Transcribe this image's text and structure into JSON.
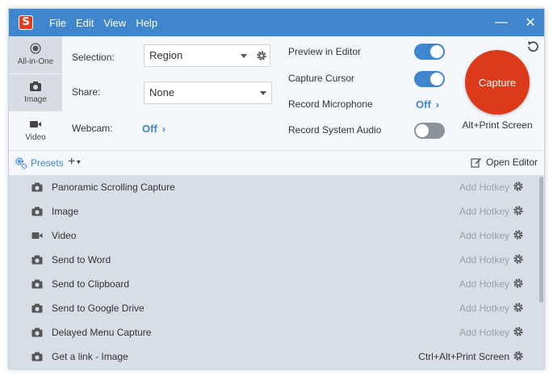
{
  "titlebar": {
    "logo_letter": "S",
    "menu": [
      "File",
      "Edit",
      "View",
      "Help"
    ],
    "minimize": "—",
    "close": "✕"
  },
  "modes": [
    {
      "label": "All-in-One",
      "icon": "radio-circle-icon"
    },
    {
      "label": "Image",
      "icon": "camera-icon"
    },
    {
      "label": "Video",
      "icon": "video-camera-icon"
    }
  ],
  "settings": {
    "selection_label": "Selection:",
    "selection_value": "Region",
    "share_label": "Share:",
    "share_value": "None",
    "webcam_label": "Webcam:",
    "webcam_value": "Off",
    "preview_label": "Preview in Editor",
    "cursor_label": "Capture Cursor",
    "mic_label": "Record Microphone",
    "mic_value": "Off",
    "sysaudio_label": "Record System Audio",
    "preview_on": true,
    "cursor_on": true,
    "sysaudio_on": false
  },
  "capture": {
    "label": "Capture",
    "hotkey": "Alt+Print Screen"
  },
  "presets": {
    "label": "Presets",
    "add": "+",
    "open_editor": "Open Editor",
    "items": [
      {
        "name": "Panoramic Scrolling Capture",
        "icon": "camera-icon",
        "hotkey": "Add Hotkey",
        "set": false
      },
      {
        "name": "Image",
        "icon": "camera-icon",
        "hotkey": "Add Hotkey",
        "set": false
      },
      {
        "name": "Video",
        "icon": "video-camera-icon",
        "hotkey": "Add Hotkey",
        "set": false
      },
      {
        "name": "Send to Word",
        "icon": "camera-icon",
        "hotkey": "Add Hotkey",
        "set": false
      },
      {
        "name": "Send to Clipboard",
        "icon": "camera-icon",
        "hotkey": "Add Hotkey",
        "set": false
      },
      {
        "name": "Send to Google Drive",
        "icon": "camera-icon",
        "hotkey": "Add Hotkey",
        "set": false
      },
      {
        "name": "Delayed Menu Capture",
        "icon": "camera-icon",
        "hotkey": "Add Hotkey",
        "set": false
      },
      {
        "name": "Get a link - Image",
        "icon": "camera-icon",
        "hotkey": "Ctrl+Alt+Print Screen",
        "set": true
      }
    ]
  },
  "colors": {
    "accent": "#3f86cf",
    "capture": "#dc3a1a",
    "toggle_off": "#8c939b"
  }
}
